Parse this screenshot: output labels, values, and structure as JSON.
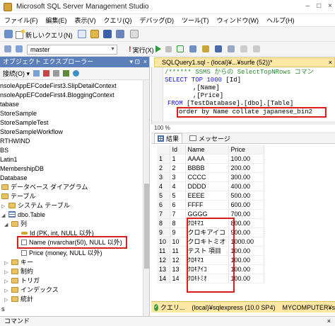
{
  "window": {
    "title": "Microsoft SQL Server Management Studio",
    "controls": [
      "–",
      "□",
      "×"
    ]
  },
  "menu": [
    "ファイル(F)",
    "編集(E)",
    "表示(V)",
    "クエリ(Q)",
    "デバッグ(D)",
    "ツール(T)",
    "ウィンドウ(W)",
    "ヘルプ(H)"
  ],
  "toolbar": {
    "new_query": "新しいクエリ(N)",
    "database": "master",
    "execute": "実行(X)"
  },
  "object_explorer": {
    "title": "オブジェクト エクスプローラー",
    "pin": "▾ ⊡",
    "close": "×",
    "connect": "接続(O)",
    "items": [
      "nsoleAppEFCodeFirst3.SlipDetailContext",
      "nsoleAppEFCodeFirst4.BloggingContext",
      "tabase",
      "StoreSample",
      "StoreSampleTest",
      "StoreSampleWorkflow",
      "RTHWIND",
      "BS",
      "Latin1",
      "MembershipDB",
      "Database"
    ],
    "db_diagram": "データベース ダイアグラム",
    "tables": "テーブル",
    "system_tables": "システム テーブル",
    "table_name": "dbo.Table",
    "columns_folder": "列",
    "col_id": "Id (PK, int, NULL 以外)",
    "col_name": "Name (nvarchar(50), NULL 以外)",
    "col_price": "Price (money, NULL 以外)",
    "keys": "キー",
    "constraints": "制約",
    "triggers": "トリガ",
    "indexes": "インデックス",
    "statistics": "統計",
    "more": "s"
  },
  "editor": {
    "tab": "SQLQuery1.sql - (local)¥...¥surfe (52))*",
    "tab_close": "×",
    "lines": {
      "comment": "/****** SSMS からの SelectTopNRows コマン",
      "select": "SELECT TOP 1000",
      "col_id": "[Id]",
      "col_name": ",[Name]",
      "col_price": ",[Price]",
      "from_kw": "FROM",
      "from_obj": "[TestDatabase].[dbo].[Table]",
      "order_by": "order by Name collate japanese_bin2"
    },
    "zoom": "100 %"
  },
  "results": {
    "tabs": [
      "結果",
      "メッセージ"
    ],
    "columns": [
      "Id",
      "Name",
      "Price"
    ],
    "rows": [
      [
        "1",
        "1",
        "AAAA",
        "100.00"
      ],
      [
        "2",
        "2",
        "BBBB",
        "200.00"
      ],
      [
        "3",
        "3",
        "CCCC",
        "300.00"
      ],
      [
        "4",
        "4",
        "DDDD",
        "400.00"
      ],
      [
        "5",
        "5",
        "EEEE",
        "500.00"
      ],
      [
        "6",
        "6",
        "FFFF",
        "600.00"
      ],
      [
        "7",
        "7",
        "GGGG",
        "700.00"
      ],
      [
        "8",
        "8",
        "ｸﾛｷﾏﾕ",
        "800.00"
      ],
      [
        "9",
        "9",
        "クロキアイコ",
        "900.00"
      ],
      [
        "10",
        "10",
        "クロキトミオ",
        "1000.00"
      ],
      [
        "11",
        "11",
        "テスト 項目",
        "100.00"
      ],
      [
        "12",
        "12",
        "ｸﾛｷﾏﾕ",
        "100.00"
      ],
      [
        "13",
        "13",
        "ｸﾛｷｱｲｺ",
        "100.00"
      ],
      [
        "14",
        "14",
        "ｸﾛｷﾄﾐｵ",
        "100.00"
      ]
    ]
  },
  "status": {
    "query": "クエリ...",
    "server": "(local)¥sqlexpress (10.0 SP4)",
    "user": "MYCOMPUTER¥surfe"
  },
  "command_bar": {
    "label": "コマンド",
    "close": "×"
  },
  "colors": {
    "accent_red": "#d81e1e",
    "status_yellow": "#fde7a4",
    "panel_header": "#5b7fb8",
    "keyword_blue": "#1b1bd6"
  }
}
